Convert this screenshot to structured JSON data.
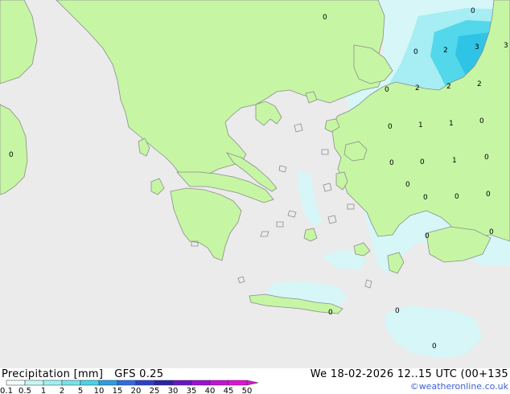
{
  "header": {
    "title": "Precipitation [mm]",
    "model": "GFS 0.25",
    "timestamp": "We 18-02-2026 12..15 UTC (00+135"
  },
  "footer": {
    "credit": "©weatheronline.co.uk"
  },
  "legend": {
    "ticks": [
      "0.1",
      "0.5",
      "1",
      "2",
      "5",
      "10",
      "15",
      "20",
      "25",
      "30",
      "35",
      "40",
      "45",
      "50"
    ],
    "colors": [
      "#f2fefe",
      "#c6f6f6",
      "#a0eef4",
      "#78e2ee",
      "#4ad3e8",
      "#2c9ee0",
      "#2f6ce0",
      "#2e3fcc",
      "#2a24a8",
      "#6a14c8",
      "#9a10d4",
      "#c410d8",
      "#e012d6"
    ]
  },
  "map": {
    "colors": {
      "sea": "#ebebeb",
      "land": "#c6f6a4",
      "coast": "#8c8c8c",
      "precip_light": "#d6f6f8",
      "precip_mid": "#a6edf4",
      "precip_heavy": "#52d8ea",
      "precip_heaviest": "#2fc4e6"
    },
    "values": [
      {
        "v": "0"
      },
      {
        "v": "0"
      },
      {
        "v": "2"
      },
      {
        "v": "3"
      },
      {
        "v": "3"
      },
      {
        "v": "0"
      },
      {
        "v": "2"
      },
      {
        "v": "2"
      },
      {
        "v": "2"
      },
      {
        "v": "0"
      },
      {
        "v": "1"
      },
      {
        "v": "1"
      },
      {
        "v": "0"
      },
      {
        "v": "0"
      },
      {
        "v": "0"
      },
      {
        "v": "1"
      },
      {
        "v": "0"
      },
      {
        "v": "0"
      },
      {
        "v": "0"
      },
      {
        "v": "0"
      },
      {
        "v": "0"
      },
      {
        "v": "0"
      },
      {
        "v": "0"
      },
      {
        "v": "0"
      },
      {
        "v": "0"
      },
      {
        "v": "0"
      },
      {
        "v": "0"
      },
      {
        "v": "0"
      }
    ]
  }
}
